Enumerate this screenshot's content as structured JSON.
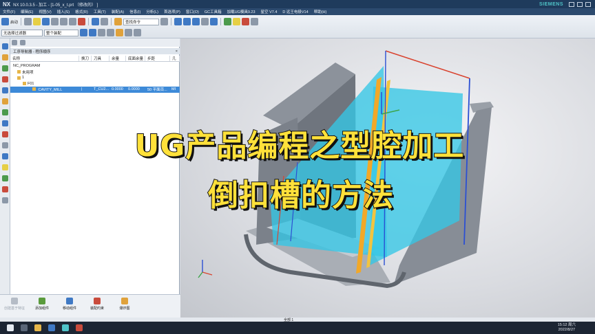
{
  "titlebar": {
    "logo": "NX",
    "title": "NX 10.0.3.5 - 加工 - [1-05_x_t.prt （修改的） ]",
    "brand": "SIEMENS"
  },
  "menu": [
    "文件(F)",
    "编辑(E)",
    "视图(V)",
    "插入(S)",
    "格式(R)",
    "工具(T)",
    "装配(A)",
    "信息(I)",
    "分析(L)",
    "首选项(P)",
    "窗口(O)",
    "GC工具箱",
    "加载UG模具9.23",
    "星空 V7.4",
    "D 远王电极V14",
    "帮助(H)"
  ],
  "toolbar": {
    "start_label": "启动",
    "view_search": "查找命令",
    "filter_select": "无选择过滤器",
    "assembly_select": "整个装配"
  },
  "navigator": {
    "header": "工序导航器 - 程序顺序",
    "columns": [
      "名称",
      "换刀",
      "刀具",
      "余量",
      "底面余量",
      "步距",
      "几"
    ],
    "rows": [
      {
        "name": "NC_PROGRAM",
        "indent": 0,
        "selected": false
      },
      {
        "name": "未用项",
        "indent": 1,
        "selected": false
      },
      {
        "name": "1",
        "indent": 1,
        "selected": false
      },
      {
        "name": "F01",
        "indent": 2,
        "selected": false
      },
      {
        "name": "CAVITY_MILL",
        "indent": 3,
        "selected": true,
        "tool": "T_CU2...",
        "stock": "0.0000",
        "floor_stock": "0.0000",
        "stepover": "50 平面百...",
        "extra": "MI"
      }
    ]
  },
  "bottom_buttons": [
    {
      "label": "创建基于特征",
      "disabled": true,
      "color": "#9aa3ae"
    },
    {
      "label": "添加组件",
      "disabled": false,
      "color": "#5a9b3c"
    },
    {
      "label": "移动组件",
      "disabled": false,
      "color": "#3f79c4"
    },
    {
      "label": "装配约束",
      "disabled": false,
      "color": "#c94b3c"
    },
    {
      "label": "爆炸图",
      "disabled": false,
      "color": "#e0a23b"
    }
  ],
  "overlay": {
    "line1": "UG产品编程之型腔加工",
    "line2": "倒扣槽的方法"
  },
  "status": {
    "text": "全部 1"
  },
  "taskbar": {
    "time": "15:12 周六",
    "date": "2022/8/27"
  }
}
